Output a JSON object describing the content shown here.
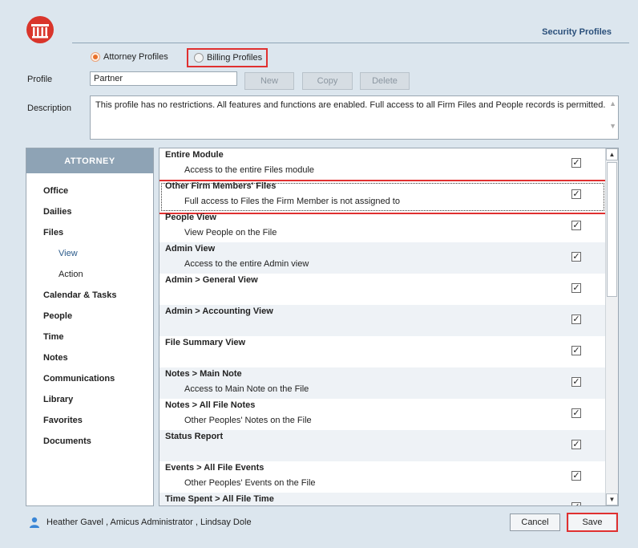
{
  "header": {
    "title": "Security Profiles"
  },
  "profile_type": {
    "attorney_label": "Attorney Profiles",
    "billing_label": "Billing Profiles",
    "selected": "Attorney Profiles"
  },
  "profile": {
    "label": "Profile",
    "value": "Partner",
    "new_label": "New",
    "copy_label": "Copy",
    "delete_label": "Delete"
  },
  "description": {
    "label": "Description",
    "value": "This profile has no restrictions. All features and functions are enabled. Full access to all Firm Files and People records is permitted."
  },
  "sidebar": {
    "header": "ATTORNEY",
    "items": [
      {
        "label": "Office"
      },
      {
        "label": "Dailies"
      },
      {
        "label": "Files"
      },
      {
        "label": "View"
      },
      {
        "label": "Action"
      },
      {
        "label": "Calendar & Tasks"
      },
      {
        "label": "People"
      },
      {
        "label": "Time"
      },
      {
        "label": "Notes"
      },
      {
        "label": "Communications"
      },
      {
        "label": "Library"
      },
      {
        "label": "Favorites"
      },
      {
        "label": "Documents"
      }
    ]
  },
  "permissions": [
    {
      "title": "Entire Module",
      "desc": "Access to the entire Files module",
      "checked": true
    },
    {
      "title": "Other Firm Members' Files",
      "desc": "Full access to Files the Firm Member is not assigned to",
      "checked": true
    },
    {
      "title": "People View",
      "desc": "View People on the File",
      "checked": true
    },
    {
      "title": "Admin View",
      "desc": "Access to the entire Admin view",
      "checked": true
    },
    {
      "title": "Admin > General View",
      "desc": "",
      "checked": true
    },
    {
      "title": "Admin > Accounting View",
      "desc": "",
      "checked": true
    },
    {
      "title": "File Summary View",
      "desc": "",
      "checked": true
    },
    {
      "title": "Notes > Main Note",
      "desc": "Access to Main Note on the File",
      "checked": true
    },
    {
      "title": "Notes > All File Notes",
      "desc": "Other Peoples' Notes on the File",
      "checked": true
    },
    {
      "title": "Status Report",
      "desc": "",
      "checked": true
    },
    {
      "title": "Events > All File Events",
      "desc": "Other Peoples' Events on the File",
      "checked": true
    },
    {
      "title": "Time Spent > All File Time",
      "desc": "",
      "checked": true
    }
  ],
  "footer": {
    "users": "Heather Gavel , Amicus Administrator , Lindsay Dole",
    "cancel_label": "Cancel",
    "save_label": "Save"
  },
  "colors": {
    "accent": "#2a4f7a",
    "highlight": "#e03030",
    "radio_selected": "#e8702a"
  }
}
